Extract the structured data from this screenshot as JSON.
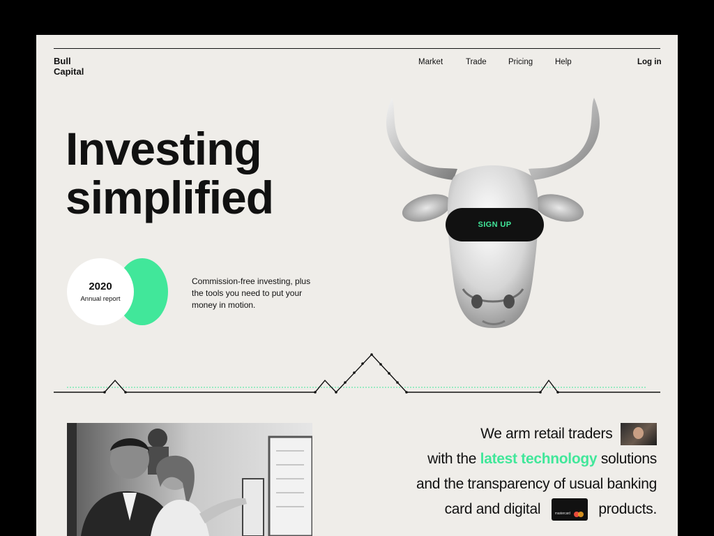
{
  "brand": {
    "line1": "Bull",
    "line2": "Capital"
  },
  "nav": {
    "items": [
      "Market",
      "Trade",
      "Pricing",
      "Help"
    ],
    "login": "Log in"
  },
  "hero": {
    "title_line1": "Investing",
    "title_line2": "simplified"
  },
  "badge": {
    "year": "2020",
    "label": "Annual report"
  },
  "tagline": "Commission-free investing, plus the tools you need to put your money in motion.",
  "signup_label": "SIGN UP",
  "mission": {
    "part1": "We arm retail traders",
    "part2": "with the",
    "highlight": "latest technology",
    "part3": "solutions",
    "part4": "and the transparency of usual banking",
    "part5": "card and digital",
    "part6": "products."
  },
  "card_label": "mastercard",
  "colors": {
    "accent": "#41e79a",
    "background": "#efede9",
    "ink": "#111111"
  }
}
